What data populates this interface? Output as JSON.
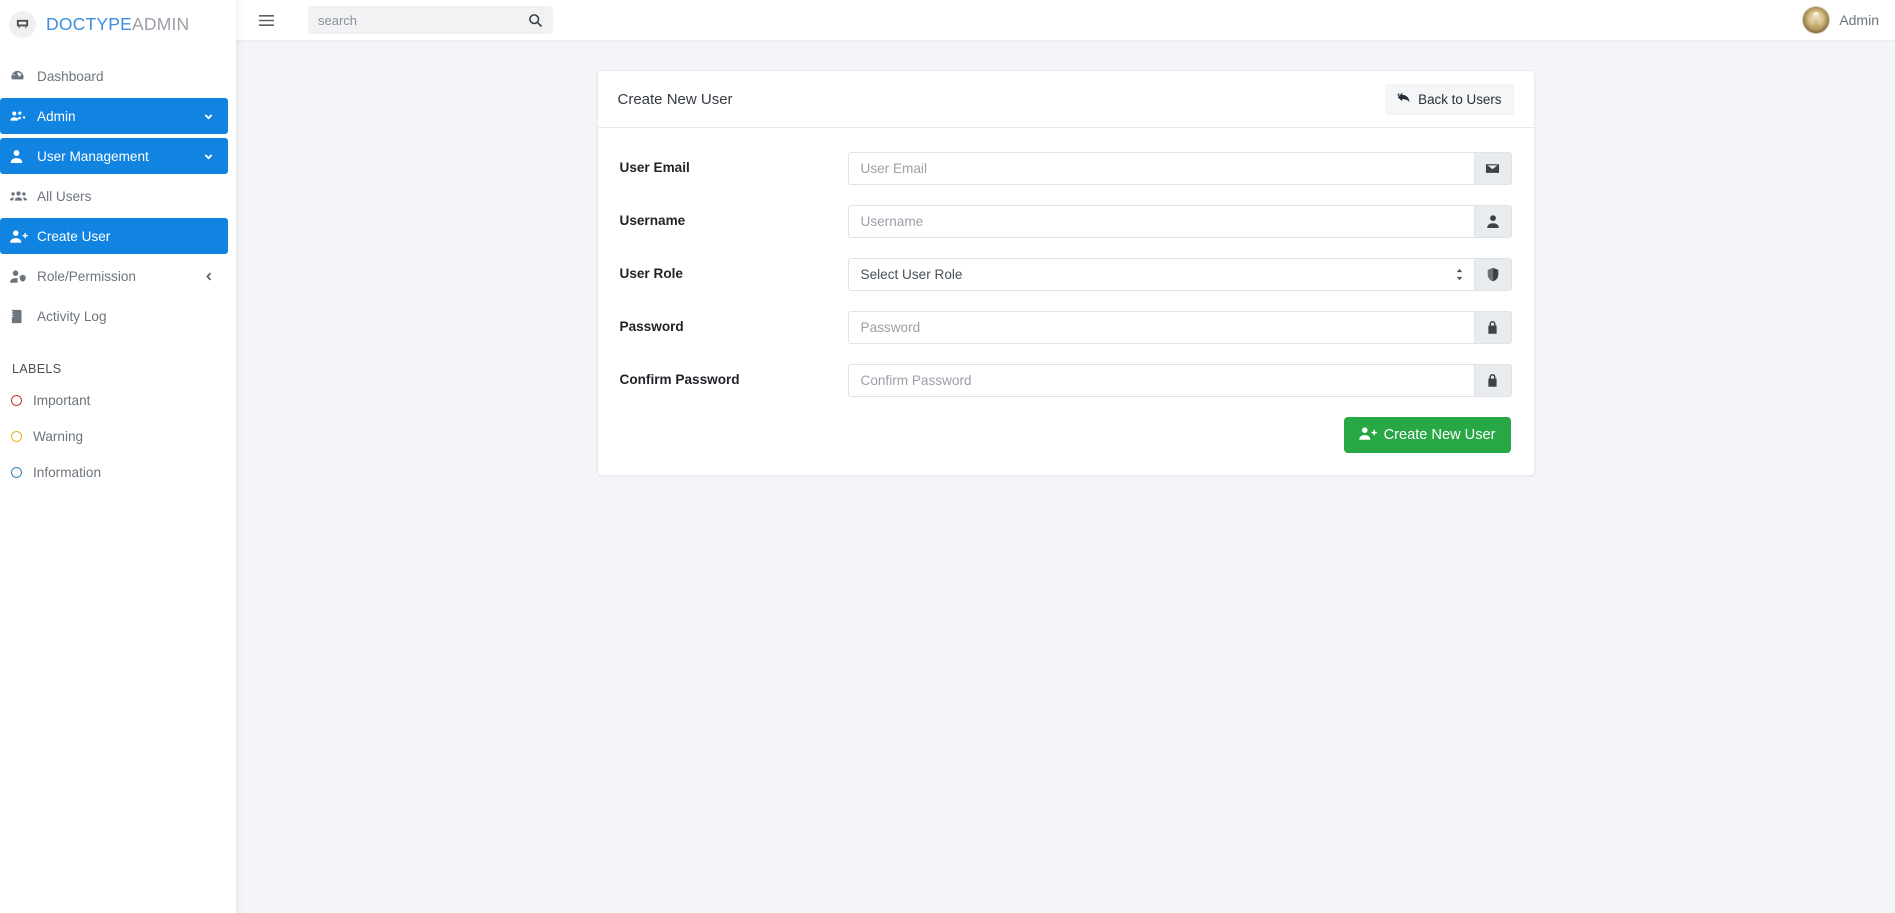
{
  "brand": {
    "logo_icon": "doctype-logo-icon",
    "name_primary": "DOCTYPE",
    "name_secondary": "ADMIN"
  },
  "sidebar": {
    "items": [
      {
        "label": "Dashboard",
        "icon": "dashboard-icon",
        "active": false,
        "caret": ""
      },
      {
        "label": "Admin",
        "icon": "users-cog-icon",
        "active": true,
        "caret": "down"
      },
      {
        "label": "User Management",
        "icon": "user-icon",
        "active": true,
        "caret": "down"
      },
      {
        "label": "All Users",
        "icon": "users-icon",
        "active": false,
        "caret": ""
      },
      {
        "label": "Create User",
        "icon": "user-plus-icon",
        "active": true,
        "caret": ""
      },
      {
        "label": "Role/Permission",
        "icon": "user-shield-icon",
        "active": false,
        "caret": "left"
      },
      {
        "label": "Activity Log",
        "icon": "book-icon",
        "active": false,
        "caret": ""
      }
    ],
    "labels_heading": "LABELS",
    "labels": [
      {
        "label": "Important",
        "color": "#c0392b"
      },
      {
        "label": "Warning",
        "color": "#edb21d"
      },
      {
        "label": "Information",
        "color": "#2e86c1"
      }
    ]
  },
  "topbar": {
    "menu_toggle_icon": "hamburger-icon",
    "search": {
      "placeholder": "search",
      "value": "",
      "button_icon": "search-icon"
    },
    "user": {
      "name": "Admin",
      "avatar_icon": "avatar"
    }
  },
  "card": {
    "title": "Create New User",
    "back_button": {
      "label": "Back to Users",
      "icon": "reply-icon"
    },
    "fields": [
      {
        "label": "User Email",
        "placeholder": "User Email",
        "value": "",
        "type": "email",
        "addon_icon": "envelope-icon"
      },
      {
        "label": "Username",
        "placeholder": "Username",
        "value": "",
        "type": "text",
        "addon_icon": "user-icon"
      },
      {
        "label": "User Role",
        "placeholder": "Select User Role",
        "value": "Select User Role",
        "type": "select",
        "addon_icon": "shield-icon"
      },
      {
        "label": "Password",
        "placeholder": "Password",
        "value": "",
        "type": "password",
        "addon_icon": "lock-icon"
      },
      {
        "label": "Confirm Password",
        "placeholder": "Confirm Password",
        "value": "",
        "type": "password",
        "addon_icon": "lock-icon"
      }
    ],
    "select_options": [
      "Select User Role"
    ],
    "submit_button": {
      "label": "Create New User",
      "icon": "user-plus-icon",
      "color": "#28a745"
    }
  },
  "colors": {
    "sidebar_active": "#1183e0",
    "brand_primary": "#3d8ce0",
    "page_background": "#f4f5f9",
    "submit_green": "#28a745"
  }
}
